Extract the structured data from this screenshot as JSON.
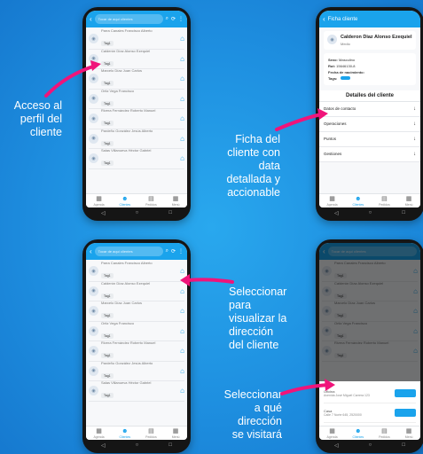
{
  "callouts": {
    "profile_access": "Acceso al\nperfil del\ncliente",
    "detail_screen": "Ficha del\ncliente con\ndata\ndetallada y\naccionable",
    "view_address": "Seleccionar\npara\nvisualizar la\ndirección\ndel cliente",
    "visit_address": "Seleccionar\na qué\ndirección\nse visitará"
  },
  "colors": {
    "accent": "#1aa3ec",
    "arrow": "#f0147a",
    "background": "#1e8fe0"
  },
  "list_screen": {
    "search_placeholder": "Tocar de aquí clientes",
    "clients": [
      {
        "name": "Parra Canales Francisco Alberto",
        "tag": "Tag1"
      },
      {
        "name": "Calderón Díaz Alonso Ezequiel",
        "tag": "Tag1"
      },
      {
        "name": "Marcelo Díaz Juan Carlos",
        "tag": "Tag1"
      },
      {
        "name": "Ortiz Vega Francisco",
        "tag": "Tag1"
      },
      {
        "name": "Rivera Fernández Roberto Manuel",
        "tag": "Tag1"
      },
      {
        "name": "Pardeño González Jesús Alberto",
        "tag": "Tag1"
      },
      {
        "name": "Salas Villanueva Héctor Gabriel",
        "tag": "Tag1"
      }
    ],
    "nav": [
      "Agenda",
      "Clientes",
      "Pedidos",
      "Menú"
    ]
  },
  "detail_screen": {
    "header": "Ficha cliente",
    "client_name": "Calderon Diaz Alonso Ezequiel",
    "client_subtitle": "Medio",
    "sex_label": "Sexo:",
    "sex_value": "Masculino",
    "rut_label": "Rut:",
    "rut_value": "15646130-8",
    "birth_label": "Fecha de nacimiento:",
    "tags_label": "Tags:",
    "section_title": "Detalles del cliente",
    "sections": [
      "Datos de contacto",
      "Operaciones",
      "Puntos",
      "Gestiones"
    ]
  },
  "address_sheet": {
    "addresses": [
      {
        "type": "Oficina",
        "text": "Avenida José Miguel Carrera 123"
      },
      {
        "type": "Casa",
        "text": "Calle 7 Norte 645, 2520000"
      }
    ]
  }
}
